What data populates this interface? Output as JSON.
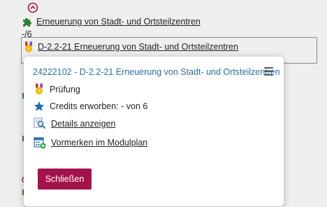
{
  "tree": {
    "node_label": "Erneuerung von Stadt- und Ortsteilzentren",
    "count_label": "-/6",
    "module_label": "D-2.2-21 Erneuerung von Stadt- und Ortsteilzentren"
  },
  "popup": {
    "title": "24222102 - D-2.2-21 Erneuerung von Stadt- und Ortsteilzentren",
    "exam_label": "Prüfung",
    "credits_label": "Credits erworben: - von 6",
    "details_link": "Details anzeigen",
    "plan_link": "Vormerken im Modulplan",
    "close_label": "Schließen"
  },
  "colors": {
    "accent": "#a3124a",
    "title": "#2e6da4",
    "puzzle": "#2f7d32",
    "star": "#1f6fb8"
  }
}
